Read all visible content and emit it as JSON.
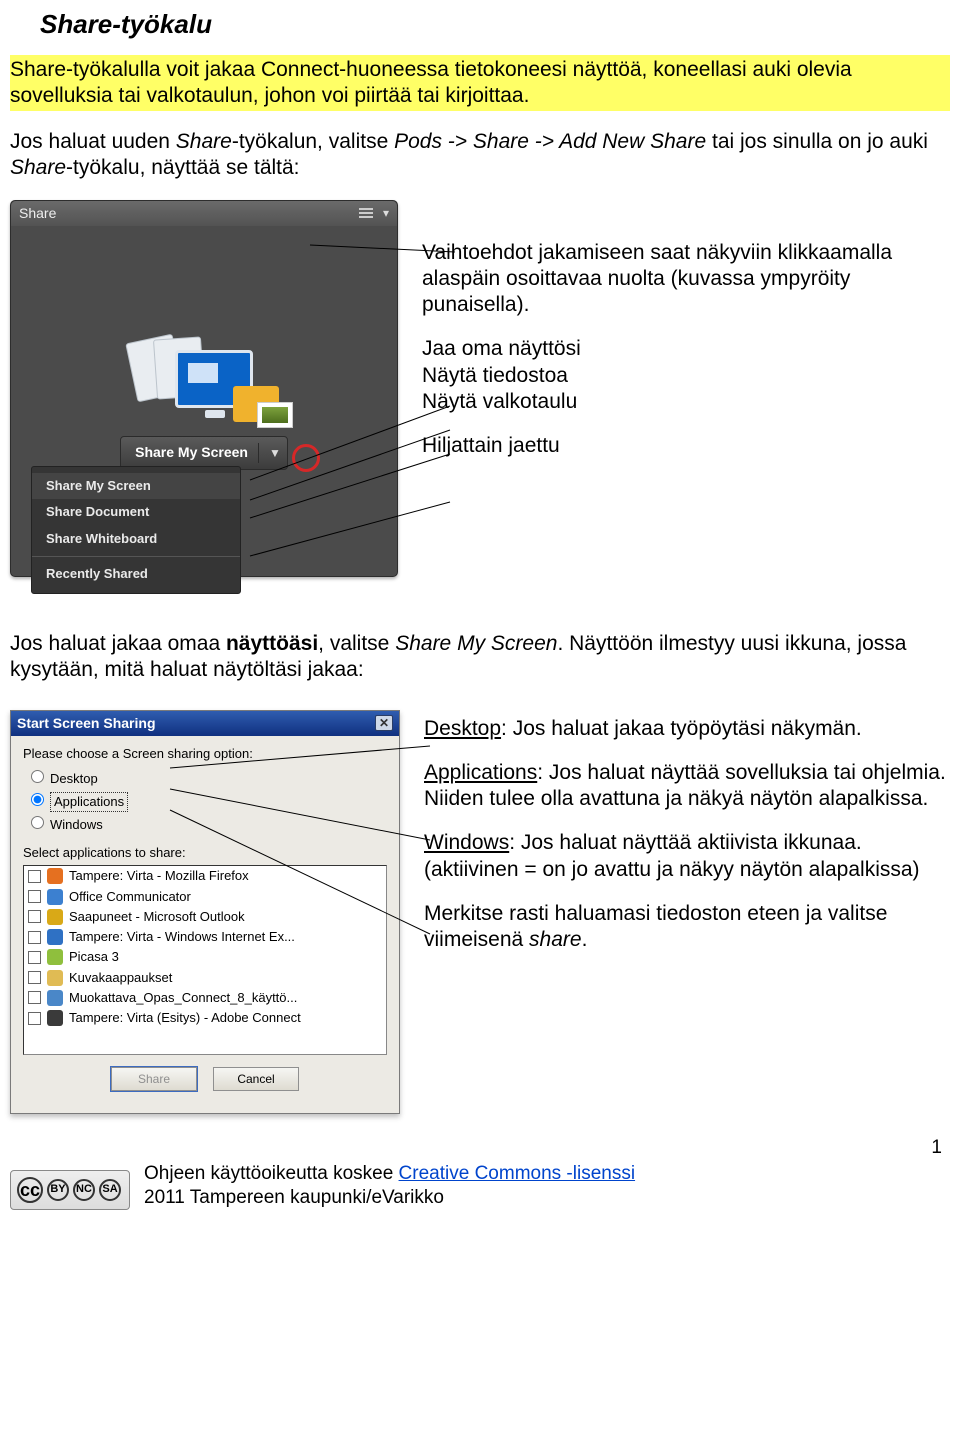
{
  "title": "Share-työkalu",
  "highlighted": "Share-työkalulla voit jakaa Connect-huoneessa tietokoneesi näyttöä, koneellasi auki olevia sovelluksia tai valkotaulun, johon voi piirtää tai kirjoittaa.",
  "intro_prefix": "Jos haluat uuden ",
  "intro_italic1": "Share",
  "intro_mid1": "-työkalun, valitse ",
  "intro_italic2": "Pods -> Share -> Add New Share",
  "intro_mid2": " tai jos sinulla on jo auki ",
  "intro_italic3": "Share",
  "intro_tail": "-työkalu, näyttää se tältä:",
  "share_pod": {
    "title": "Share",
    "button": "Share My Screen",
    "menu": {
      "screen": "Share My Screen",
      "document": "Share Document",
      "whiteboard": "Share Whiteboard",
      "recent": "Recently Shared"
    }
  },
  "callouts": {
    "dropdown": "Vaihtoehdot jakamiseen saat näkyviin klikkaamalla alaspäin osoittavaa nuolta (kuvassa ympyröity punaisella).",
    "screen": "Jaa oma näyttösi",
    "document": "Näytä tiedostoa",
    "whiteboard": "Näytä valkotaulu",
    "recent": "Hiljattain jaettu"
  },
  "para2_a": "Jos haluat jakaa omaa ",
  "para2_bold": "näyttöäsi",
  "para2_b": ", valitse ",
  "para2_italic": "Share My Screen",
  "para2_c": ". Näyttöön ilmestyy uusi ikkuna, jossa kysytään, mitä haluat näytöltäsi jakaa:",
  "dlg": {
    "title": "Start Screen Sharing",
    "prompt": "Please choose a Screen sharing option:",
    "r_desktop": "Desktop",
    "r_applications": "Applications",
    "r_windows": "Windows",
    "sub": "Select applications to share:",
    "apps": [
      "Tampere: Virta - Mozilla Firefox",
      "Office Communicator",
      "Saapuneet - Microsoft Outlook",
      "Tampere: Virta - Windows Internet Ex...",
      "Picasa 3",
      "Kuvakaappaukset",
      "Muokattava_Opas_Connect_8_käyttö...",
      "Tampere: Virta (Esitys) - Adobe Connect"
    ],
    "btn_share": "Share",
    "btn_cancel": "Cancel"
  },
  "expl": {
    "desktop": "Desktop: Jos haluat jakaa työpöytäsi näkymän.",
    "applications": "Applications: Jos haluat näyttää sovelluksia tai ohjelmia. Niiden tulee olla avattuna ja näkyä näytön alapalkissa.",
    "windows": "Windows: Jos haluat näyttää aktiivista ikkunaa. (aktiivinen = on jo avattu ja näkyy näytön alapalkissa)",
    "final_a": "Merkitse rasti haluamasi tiedoston eteen ja valitse viimeisenä ",
    "final_italic": "share",
    "final_b": "."
  },
  "footer": {
    "line1a": "Ohjeen käyttöoikeutta koskee ",
    "link": "Creative Commons -lisenssi",
    "line2": "2011 Tampereen kaupunki/eVarikko"
  },
  "page_num": "1",
  "icon_colors": [
    "#e57020",
    "#3c80d0",
    "#d9a917",
    "#2f71c4",
    "#8fbf3d",
    "#e0bb54",
    "#4a87c8",
    "#3a3a3a"
  ]
}
